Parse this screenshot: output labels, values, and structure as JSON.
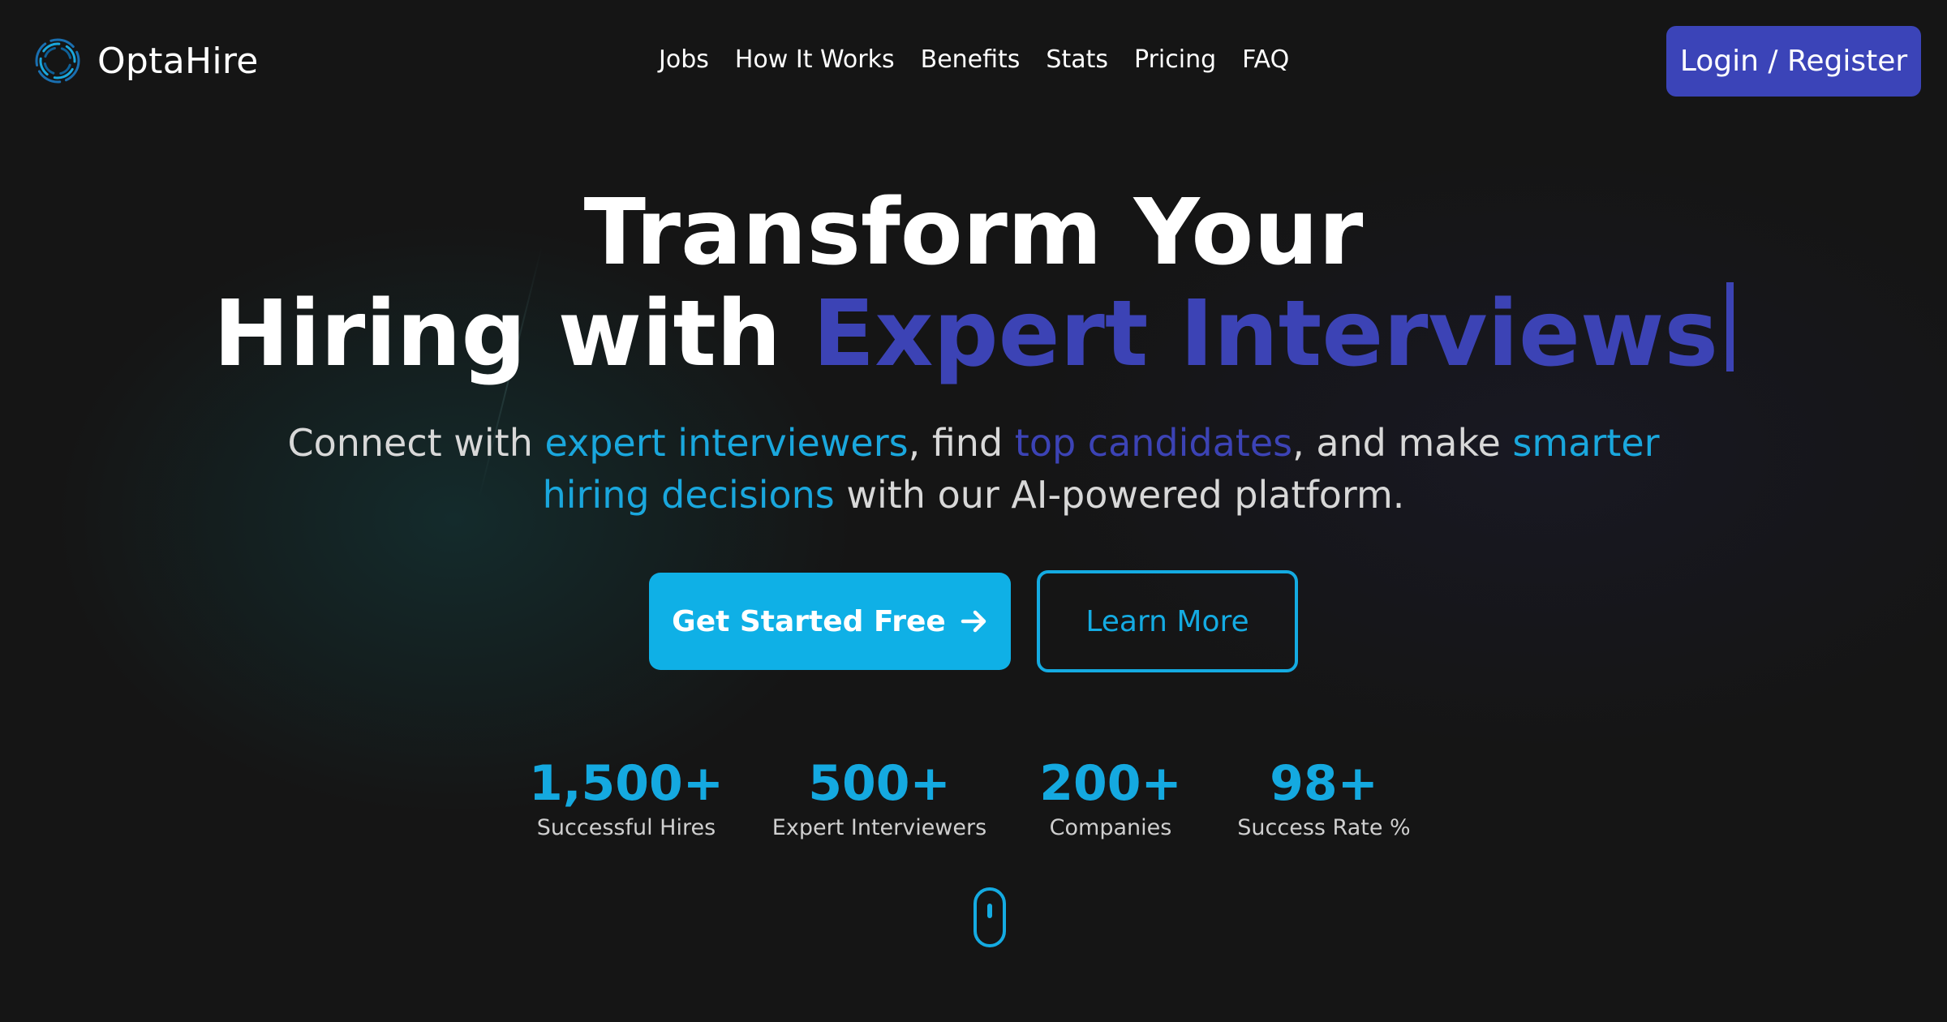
{
  "brand": {
    "name": "OptaHire",
    "logo_icon": "swirl-ring-icon",
    "accent_color": "#1aa7dd"
  },
  "nav": {
    "links": [
      "Jobs",
      "How It Works",
      "Benefits",
      "Stats",
      "Pricing",
      "FAQ"
    ],
    "login_label": "Login / Register",
    "login_color": "#3b44b8"
  },
  "hero": {
    "title_line1": "Transform Your",
    "title_line2_prefix": "Hiring with ",
    "title_line2_accent": "Expert Interviews",
    "accent_color": "#3c43b5",
    "subtitle": {
      "p1": "Connect with ",
      "h1": "expert interviewers",
      "p2": ", find ",
      "h2": "top candidates",
      "p3": ", and make ",
      "h3": "smarter hiring decisions",
      "p4": " with our AI-powered platform."
    },
    "cta_primary": "Get Started Free",
    "cta_primary_icon": "arrow-right-icon",
    "cta_secondary": "Learn More"
  },
  "stats": [
    {
      "value": "1,500+",
      "label": "Successful Hires"
    },
    {
      "value": "500+",
      "label": "Expert Interviewers"
    },
    {
      "value": "200+",
      "label": "Companies"
    },
    {
      "value": "98+",
      "label": "Success Rate %"
    }
  ],
  "scroll_indicator": "mouse-scroll-icon"
}
